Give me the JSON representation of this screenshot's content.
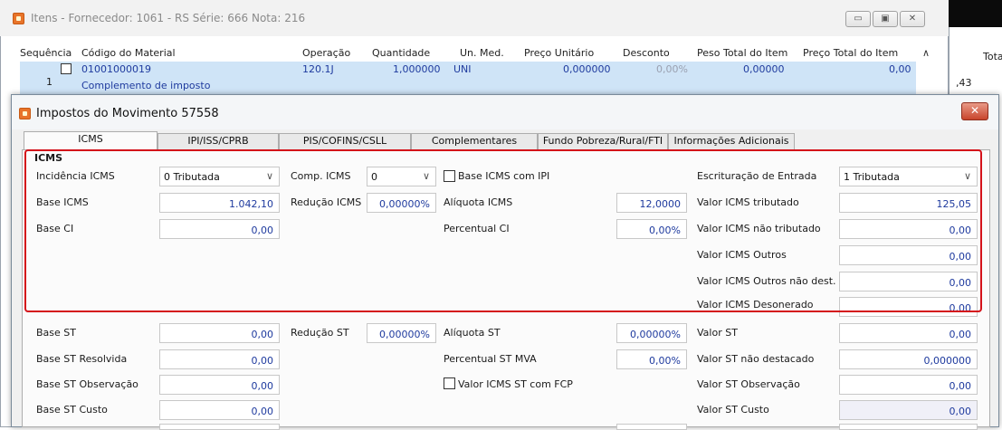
{
  "background_window": {
    "title": "Itens - Fornecedor: 1061 - RS Série: 666  Nota: 216",
    "columns": [
      "Sequência",
      "Código do Material",
      "Operação",
      "Quantidade",
      "Un. Med.",
      "Preço Unitário",
      "Desconto",
      "Peso Total do Item",
      "Preço Total do Item"
    ],
    "row": {
      "sequencia": "1",
      "codigo": "01001000019",
      "descricao": "Complemento de imposto",
      "operacao": "120.1J",
      "quantidade": "1,000000",
      "un_med": "UNI",
      "preco_unitario": "0,000000",
      "desconto": "0,00%",
      "peso_total": "0,00000",
      "preco_total": "0,00"
    },
    "right_strip": {
      "header": "Tota",
      "value": ",43"
    }
  },
  "dialog": {
    "title": "Impostos do Movimento 57558",
    "tabs": [
      "ICMS",
      "IPI/ISS/CPRB",
      "PIS/COFINS/CSLL",
      "Complementares",
      "Fundo Pobreza/Rural/FTI",
      "Informações Adicionais"
    ],
    "active_tab": "ICMS",
    "group_title": "ICMS",
    "fields": {
      "incidencia_icms": {
        "label": "Incidência ICMS",
        "value": "0 Tributada"
      },
      "comp_icms": {
        "label": "Comp. ICMS",
        "value": "0"
      },
      "base_icms_com_ipi": {
        "label": "Base ICMS com IPI"
      },
      "escrituracao_entrada": {
        "label": "Escrituração de Entrada",
        "value": "1 Tributada"
      },
      "base_icms": {
        "label": "Base ICMS",
        "value": "1.042,10"
      },
      "reducao_icms": {
        "label": "Redução ICMS",
        "value": "0,00000%"
      },
      "aliquota_icms": {
        "label": "Alíquota ICMS",
        "value": "12,0000"
      },
      "valor_icms_tributado": {
        "label": "Valor ICMS tributado",
        "value": "125,05"
      },
      "base_ci": {
        "label": "Base CI",
        "value": "0,00"
      },
      "percentual_ci": {
        "label": "Percentual CI",
        "value": "0,00%"
      },
      "valor_icms_nao_tributado": {
        "label": "Valor ICMS não tributado",
        "value": "0,00"
      },
      "valor_icms_outros": {
        "label": "Valor ICMS Outros",
        "value": "0,00"
      },
      "valor_icms_outros_nao_dest": {
        "label": "Valor ICMS Outros não dest.",
        "value": "0,00"
      },
      "valor_icms_desonerado": {
        "label": "Valor ICMS Desonerado",
        "value": "0,00"
      },
      "base_st": {
        "label": "Base ST",
        "value": "0,00"
      },
      "reducao_st": {
        "label": "Redução ST",
        "value": "0,00000%"
      },
      "aliquota_st": {
        "label": "Alíquota ST",
        "value": "0,00000%"
      },
      "valor_st": {
        "label": "Valor ST",
        "value": "0,00"
      },
      "base_st_resolvida": {
        "label": "Base ST Resolvida",
        "value": "0,00"
      },
      "percentual_st_mva": {
        "label": "Percentual ST MVA",
        "value": "0,00%"
      },
      "valor_st_nao_destacado": {
        "label": "Valor ST não destacado",
        "value": "0,000000"
      },
      "base_st_observacao": {
        "label": "Base ST Observação",
        "value": "0,00"
      },
      "valor_icms_st_com_fcp": {
        "label": "Valor ICMS ST com FCP"
      },
      "valor_st_observacao": {
        "label": "Valor ST Observação",
        "value": "0,00"
      },
      "base_st_custo": {
        "label": "Base ST Custo",
        "value": "0,00"
      },
      "valor_st_custo": {
        "label": "Valor ST Custo",
        "value": "0,00"
      }
    }
  },
  "colors": {
    "highlight": "#d4121a",
    "value_text": "#1e3a9e",
    "selected_row": "#cfe4f7"
  }
}
